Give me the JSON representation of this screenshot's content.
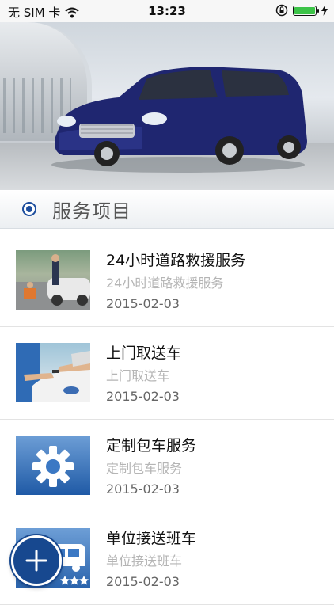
{
  "status_bar": {
    "carrier": "无 SIM 卡",
    "time": "13:23"
  },
  "section": {
    "title": "服务项目"
  },
  "services": [
    {
      "title": "24小时道路救援服务",
      "subtitle": "24小时道路救援服务",
      "date": "2015-02-03",
      "thumb_icon": "roadside-assistance-photo"
    },
    {
      "title": "上门取送车",
      "subtitle": "上门取送车",
      "date": "2015-02-03",
      "thumb_icon": "car-key-handover-photo"
    },
    {
      "title": "定制包车服务",
      "subtitle": "定制包车服务",
      "date": "2015-02-03",
      "thumb_icon": "gear-icon"
    },
    {
      "title": "单位接送班车",
      "subtitle": "单位接送班车",
      "date": "2015-02-03",
      "thumb_icon": "shuttle-bus-icon"
    }
  ],
  "colors": {
    "accent": "#1d4e9e",
    "fab": "#17488f",
    "battery": "#3cc348"
  }
}
